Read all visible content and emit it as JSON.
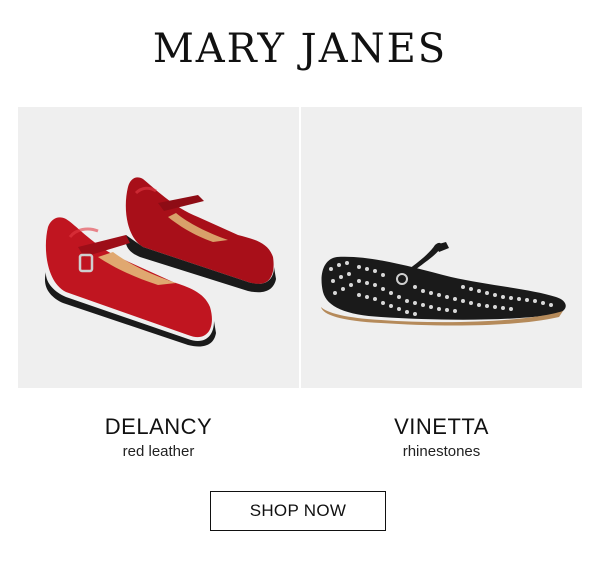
{
  "heading": "MARY JANES",
  "products": [
    {
      "name": "DELANCY",
      "description": "red leather",
      "image_icon": "red-mary-jane-shoes-image"
    },
    {
      "name": "VINETTA",
      "description": "rhinestones",
      "image_icon": "black-studded-flat-image"
    }
  ],
  "cta": {
    "label": "SHOP NOW"
  },
  "colors": {
    "background": "#ffffff",
    "panel": "#efefef",
    "shoe_red": "#b3121c",
    "shoe_black": "#1a1a1a",
    "text": "#111111"
  }
}
